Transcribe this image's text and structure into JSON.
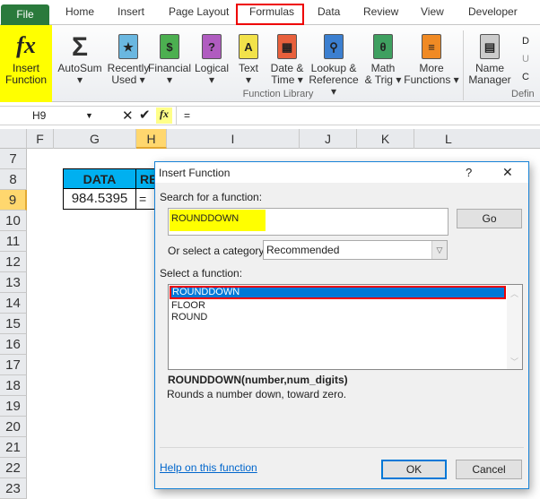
{
  "ribbon_tabs": [
    "File",
    "Home",
    "Insert",
    "Page Layout",
    "Formulas",
    "Data",
    "Review",
    "View",
    "Developer"
  ],
  "ribbon": {
    "insert_function": [
      "Insert",
      "Function"
    ],
    "buttons": [
      {
        "l1": "AutoSum",
        "l2": "▾",
        "glyph": "Σ"
      },
      {
        "l1": "Recently",
        "l2": "Used ▾",
        "glyph": "★"
      },
      {
        "l1": "Financial",
        "l2": "▾",
        "glyph": "$"
      },
      {
        "l1": "Logical",
        "l2": "▾",
        "glyph": "?"
      },
      {
        "l1": "Text",
        "l2": "▾",
        "glyph": "A"
      },
      {
        "l1": "Date &",
        "l2": "Time ▾",
        "glyph": "▦"
      },
      {
        "l1": "Lookup &",
        "l2": "Reference ▾",
        "glyph": "⚲"
      },
      {
        "l1": "Math",
        "l2": "& Trig ▾",
        "glyph": "θ"
      },
      {
        "l1": "More",
        "l2": "Functions ▾",
        "glyph": "≡"
      },
      {
        "l1": "Name",
        "l2": "Manager",
        "glyph": "▤"
      }
    ],
    "group_label": "Function Library",
    "group_label2": "Defin",
    "small": [
      "D",
      "U",
      "C"
    ]
  },
  "formula_bar": {
    "name_box": "H9",
    "formula": "="
  },
  "columns": [
    "F",
    "G",
    "H",
    "I",
    "J",
    "K",
    "L"
  ],
  "rows": [
    "7",
    "8",
    "9",
    "10",
    "11",
    "12",
    "13",
    "14",
    "15",
    "16",
    "17",
    "18",
    "19",
    "20",
    "21",
    "22",
    "23"
  ],
  "sheet": {
    "header_data": "DATA",
    "header_result": "RE",
    "value": "984.5395",
    "h9": "="
  },
  "dialog": {
    "title": "Insert Function",
    "help": "?",
    "close": "✕",
    "search_label": "Search for a function:",
    "search_value": "ROUNDDOWN",
    "go": "Go",
    "category_label": "Or select a category:",
    "category_value": "Recommended",
    "select_label": "Select a function:",
    "functions": [
      "ROUNDDOWN",
      "FLOOR",
      "ROUND"
    ],
    "signature": "ROUNDDOWN(number,num_digits)",
    "description": "Rounds a number down, toward zero.",
    "help_link": "Help on this function",
    "ok": "OK",
    "cancel": "Cancel"
  }
}
